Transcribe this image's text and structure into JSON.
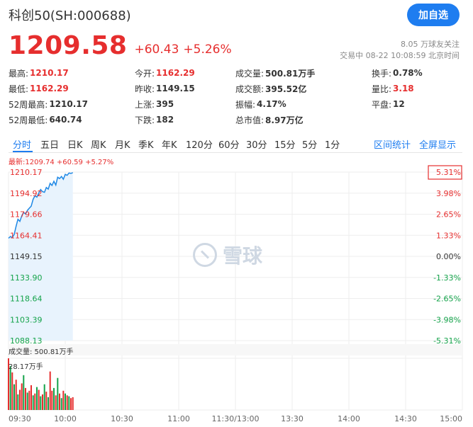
{
  "header": {
    "title": "科创50(SH:000688)",
    "add_button": "加自选",
    "price": "1209.58",
    "change": "+60.43",
    "change_pct": "+5.26%",
    "followers": "8.05 万球友关注",
    "trade_time": "交易中 08-22 10:08:59 北京时间"
  },
  "quote": {
    "rows": [
      [
        {
          "label": "最高:",
          "value": "1210.17",
          "color": "red"
        },
        {
          "label": "今开:",
          "value": "1162.29",
          "color": "red"
        },
        {
          "label": "成交量:",
          "value": "500.81万手",
          "color": "dark"
        },
        {
          "label": "换手:",
          "value": "0.78%",
          "color": "dark"
        }
      ],
      [
        {
          "label": "最低:",
          "value": "1162.29",
          "color": "red"
        },
        {
          "label": "昨收:",
          "value": "1149.15",
          "color": "dark"
        },
        {
          "label": "成交额:",
          "value": "395.52亿",
          "color": "dark"
        },
        {
          "label": "量比:",
          "value": "3.18",
          "color": "red"
        }
      ],
      [
        {
          "label": "52周最高:",
          "value": "1210.17",
          "color": "dark"
        },
        {
          "label": "上涨:",
          "value": "395",
          "color": "dark"
        },
        {
          "label": "振幅:",
          "value": "4.17%",
          "color": "dark"
        },
        {
          "label": "平盘:",
          "value": "12",
          "color": "dark"
        }
      ],
      [
        {
          "label": "52周最低:",
          "value": "640.74",
          "color": "dark"
        },
        {
          "label": "下跌:",
          "value": "182",
          "color": "dark"
        },
        {
          "label": "总市值:",
          "value": "8.97万亿",
          "color": "dark"
        }
      ]
    ]
  },
  "tabs": {
    "items": [
      "分时",
      "五日",
      "日K",
      "周K",
      "月K",
      "季K",
      "年K",
      "120分",
      "60分",
      "30分",
      "15分",
      "5分",
      "1分"
    ],
    "active": 0,
    "range_stats": "区间统计",
    "fullscreen": "全屏显示"
  },
  "chart": {
    "latest_label": "最新:1209.74 +60.59 +5.27%",
    "volume_label": "成交量: 500.81万手",
    "volume_max_label": "28.17万手",
    "watermark": "雪球",
    "colors": {
      "up": "#e62e2e",
      "down": "#14a34a",
      "flat": "#333333",
      "line": "#1e88e5",
      "fill": "#e8f3fd",
      "grid": "#eeeeee",
      "highlight_box": "#e62e2e"
    }
  },
  "chart_data": {
    "type": "line",
    "prev_close": 1149.15,
    "y_ticks": [
      "1210.17",
      "1194.92",
      "1179.66",
      "1164.41",
      "1149.15",
      "1133.90",
      "1118.64",
      "1103.39",
      "1088.13"
    ],
    "pct_ticks": [
      "5.31%",
      "3.98%",
      "2.65%",
      "1.33%",
      "0.00%",
      "-1.33%",
      "-2.65%",
      "-3.98%",
      "-5.31%"
    ],
    "x_ticks": [
      "09:30",
      "10:00",
      "10:30",
      "11:00",
      "11:30/13:00",
      "13:30",
      "14:00",
      "14:30",
      "15:00"
    ],
    "ylim": [
      1088.13,
      1210.17
    ],
    "total_minutes": 240,
    "price_series": [
      1162.3,
      1163.5,
      1162.8,
      1165.0,
      1171.0,
      1176.0,
      1174.5,
      1178.5,
      1181.0,
      1179.8,
      1182.5,
      1184.0,
      1185.5,
      1190.5,
      1193.0,
      1192.0,
      1195.0,
      1197.5,
      1196.0,
      1195.5,
      1199.0,
      1197.8,
      1202.0,
      1200.5,
      1203.5,
      1200.8,
      1206.5,
      1205.5,
      1207.0,
      1205.0,
      1208.5,
      1207.8,
      1209.5,
      1209.2,
      1209.74
    ],
    "volume_max": 28.17,
    "volume_series": [
      {
        "v": 28.17,
        "c": "up"
      },
      {
        "v": 24.0,
        "c": "down"
      },
      {
        "v": 20.5,
        "c": "up"
      },
      {
        "v": 14.0,
        "c": "down"
      },
      {
        "v": 16.5,
        "c": "up"
      },
      {
        "v": 8.5,
        "c": "down"
      },
      {
        "v": 11.0,
        "c": "up"
      },
      {
        "v": 14.5,
        "c": "up"
      },
      {
        "v": 19.0,
        "c": "down"
      },
      {
        "v": 12.0,
        "c": "up"
      },
      {
        "v": 9.5,
        "c": "down"
      },
      {
        "v": 10.5,
        "c": "up"
      },
      {
        "v": 13.5,
        "c": "up"
      },
      {
        "v": 8.0,
        "c": "down"
      },
      {
        "v": 9.0,
        "c": "up"
      },
      {
        "v": 12.5,
        "c": "down"
      },
      {
        "v": 11.0,
        "c": "up"
      },
      {
        "v": 7.5,
        "c": "down"
      },
      {
        "v": 8.5,
        "c": "up"
      },
      {
        "v": 14.0,
        "c": "down"
      },
      {
        "v": 10.0,
        "c": "up"
      },
      {
        "v": 7.0,
        "c": "down"
      },
      {
        "v": 21.0,
        "c": "up"
      },
      {
        "v": 10.5,
        "c": "up"
      },
      {
        "v": 12.0,
        "c": "down"
      },
      {
        "v": 8.0,
        "c": "up"
      },
      {
        "v": 17.5,
        "c": "down"
      },
      {
        "v": 9.0,
        "c": "up"
      },
      {
        "v": 6.5,
        "c": "down"
      },
      {
        "v": 10.5,
        "c": "up"
      },
      {
        "v": 9.0,
        "c": "down"
      },
      {
        "v": 8.0,
        "c": "up"
      },
      {
        "v": 7.5,
        "c": "down"
      },
      {
        "v": 6.5,
        "c": "up"
      },
      {
        "v": 7.0,
        "c": "up"
      }
    ]
  }
}
